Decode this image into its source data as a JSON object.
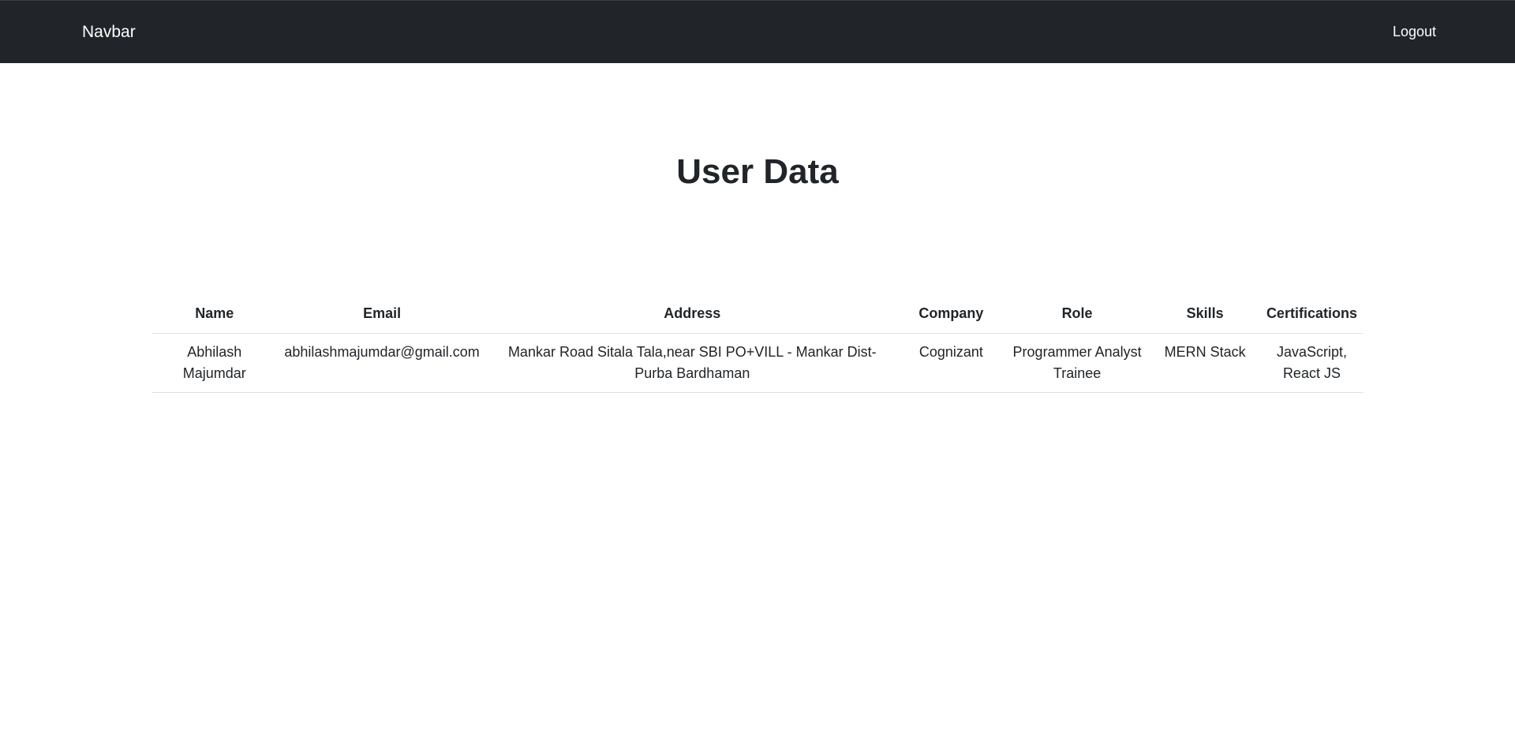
{
  "navbar": {
    "brand": "Navbar",
    "logout_label": "Logout"
  },
  "page": {
    "title": "User Data"
  },
  "table": {
    "headers": [
      "Name",
      "Email",
      "Address",
      "Company",
      "Role",
      "Skills",
      "Certifications"
    ],
    "rows": [
      {
        "name": "Abhilash Majumdar",
        "email": "abhilashmajumdar@gmail.com",
        "address": "Mankar Road Sitala Tala,near SBI PO+VILL - Mankar Dist- Purba Bardhaman",
        "company": "Cognizant",
        "role": "Programmer Analyst Trainee",
        "skills": "MERN Stack",
        "certifications": "JavaScript, React JS"
      }
    ]
  },
  "colors": {
    "navbar_bg": "#212529",
    "text": "#212529",
    "border": "#dee2e6"
  }
}
